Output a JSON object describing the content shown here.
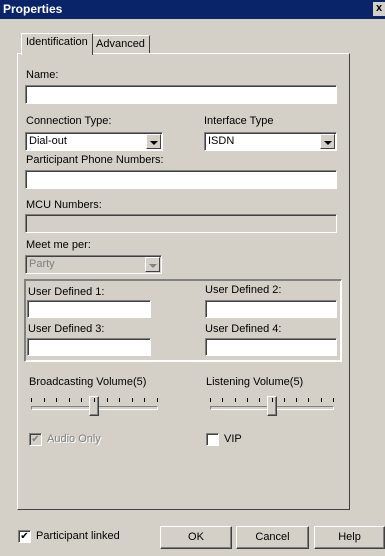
{
  "window": {
    "title": "Properties",
    "close_glyph": "x"
  },
  "tabs": [
    {
      "label": "Identification",
      "active": true
    },
    {
      "label": "Advanced",
      "active": false
    }
  ],
  "name": {
    "label": "Name:",
    "value": ""
  },
  "connection_type": {
    "label": "Connection Type:",
    "value": "Dial-out"
  },
  "interface_type": {
    "label": "Interface Type",
    "value": "ISDN"
  },
  "participant_phone": {
    "label": "Participant Phone Numbers:",
    "value": ""
  },
  "mcu_numbers": {
    "label": "MCU Numbers:",
    "value": ""
  },
  "meet_me_per": {
    "label": "Meet me per:",
    "value": "Party",
    "enabled": false
  },
  "user_defined": {
    "label_1": "User Defined 1:",
    "value_1": "",
    "label_2": "User Defined 2:",
    "value_2": "",
    "label_3": "User Defined 3:",
    "value_3": "",
    "label_4": "User Defined 4:",
    "value_4": ""
  },
  "broadcasting_volume": {
    "label": "Broadcasting Volume(5)",
    "value": 5,
    "min": 0,
    "max": 10
  },
  "listening_volume": {
    "label": "Listening Volume(5)",
    "value": 5,
    "min": 0,
    "max": 10
  },
  "audio_only": {
    "label": "Audio Only",
    "checked": true,
    "enabled": false
  },
  "vip": {
    "label": "VIP",
    "checked": false
  },
  "participant_linked": {
    "label": "Participant linked",
    "checked": true
  },
  "buttons": {
    "ok": "OK",
    "cancel": "Cancel",
    "help": "Help"
  },
  "icons": {
    "close": "close-icon",
    "dropdown": "chevron-down-icon",
    "check": "check-icon"
  }
}
